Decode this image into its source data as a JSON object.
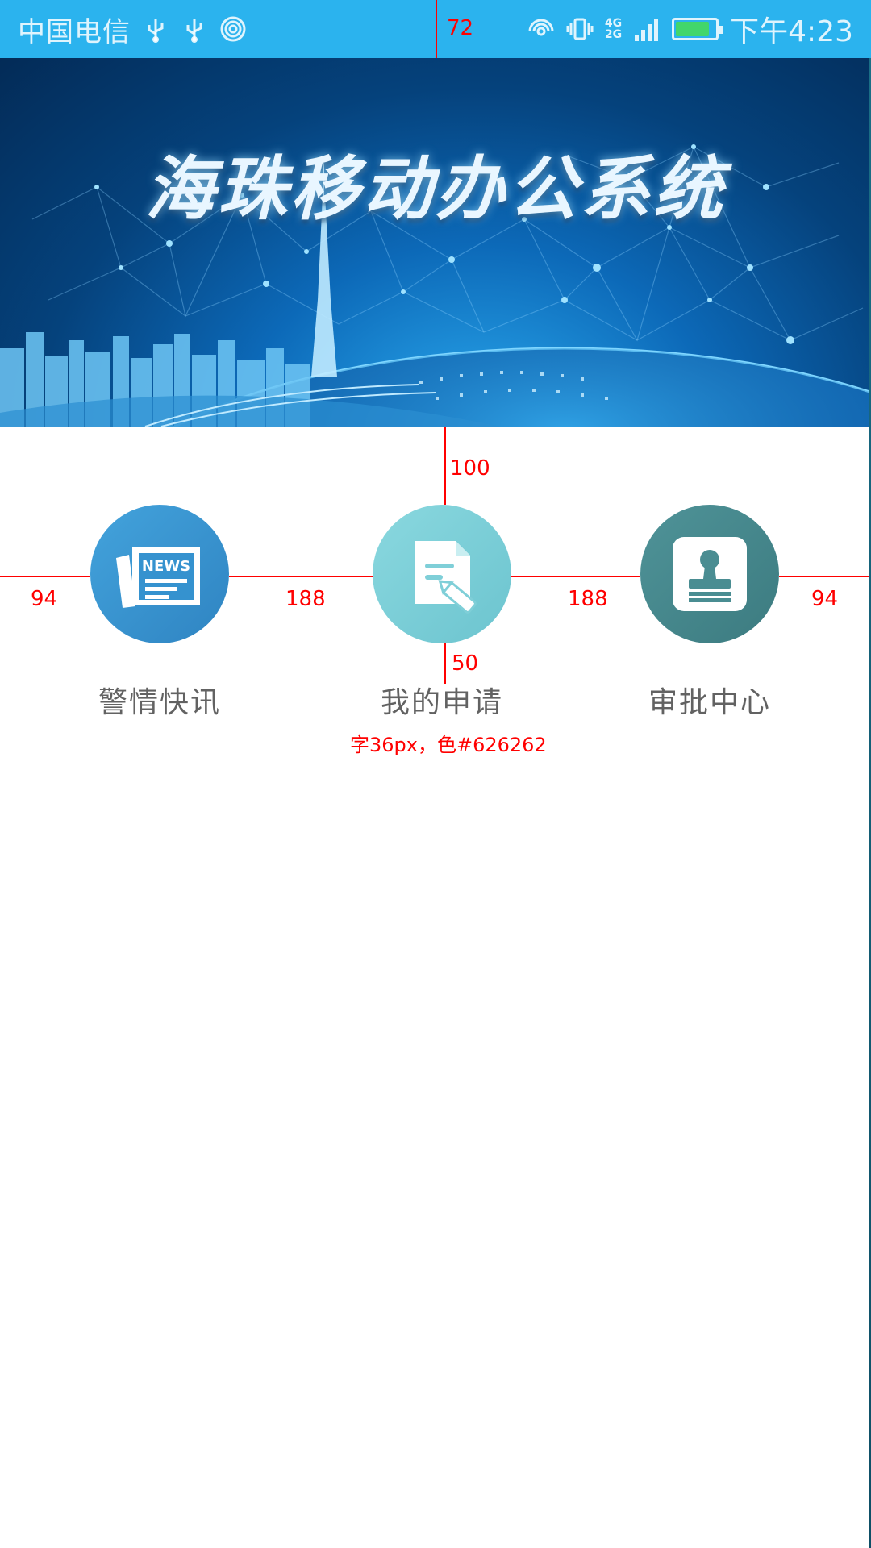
{
  "status_bar": {
    "carrier": "中国电信",
    "network_label_top": "4G",
    "network_label_bottom": "2G",
    "time": "下午4:23",
    "battery_level": 0.85,
    "color": "#2bb3ee"
  },
  "banner": {
    "title": "海珠移动办公系统"
  },
  "menu": {
    "items": [
      {
        "label": "警情快讯",
        "icon": "news-icon",
        "badge_text": "NEWS",
        "color": "#3a93d0"
      },
      {
        "label": "我的申请",
        "icon": "document-pen-icon",
        "color": "#7fcfd8"
      },
      {
        "label": "审批中心",
        "icon": "stamp-icon",
        "color": "#4a8d92"
      }
    ],
    "label_color": "#626262"
  },
  "annotations": {
    "status_height": "72",
    "top_gap": "100",
    "left_margin": "94",
    "gap_1": "188",
    "gap_2": "188",
    "right_margin": "94",
    "label_gap": "50",
    "text_spec": "字36px，色#626262",
    "color": "#ff0000"
  }
}
